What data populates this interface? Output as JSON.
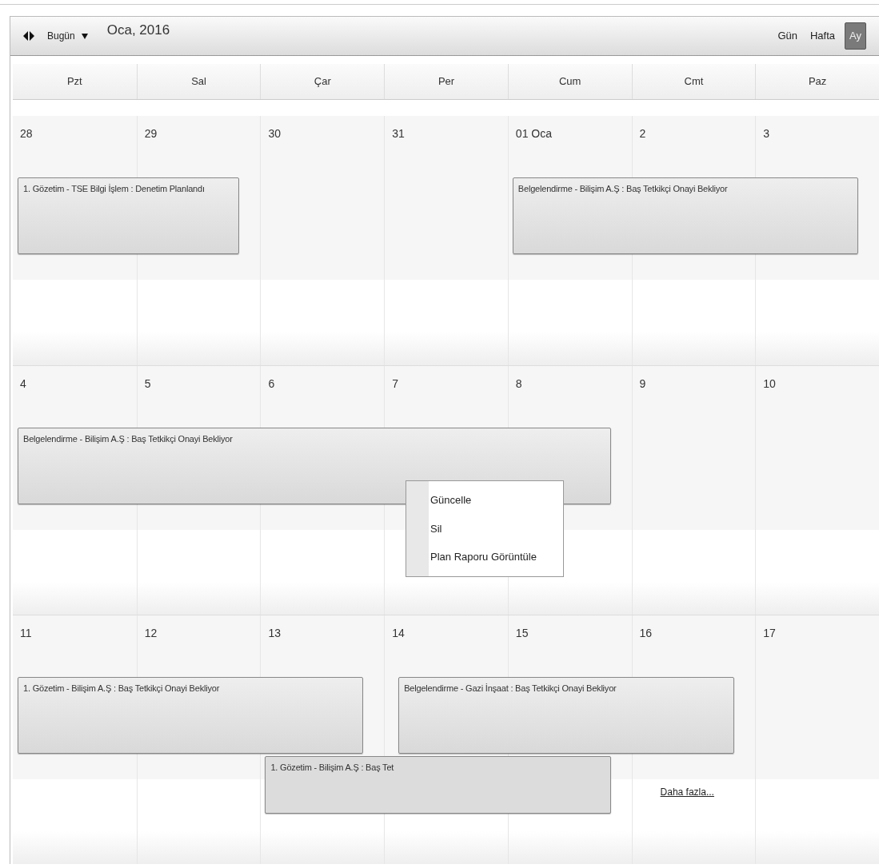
{
  "toolbar": {
    "today_button": "Bugün",
    "title": "Oca, 2016",
    "views": [
      {
        "label": "Gün",
        "selected": false
      },
      {
        "label": "Hafta",
        "selected": false
      },
      {
        "label": "Ay",
        "selected": true
      }
    ]
  },
  "weekdays": [
    "Pzt",
    "Sal",
    "Çar",
    "Per",
    "Cum",
    "Cmt",
    "Paz"
  ],
  "weeks": [
    {
      "days": [
        {
          "label": "28"
        },
        {
          "label": "29"
        },
        {
          "label": "30"
        },
        {
          "label": "31"
        },
        {
          "label": "01 Oca"
        },
        {
          "label": "2"
        },
        {
          "label": "3"
        }
      ],
      "events": [
        {
          "title": "1. Gözetim - TSE Bilgi İşlem : Denetim Planlandı"
        },
        {
          "title": "Belgelendirme - Bilişim A.Ş : Baş Tetkikçi Onayi Bekliyor"
        }
      ]
    },
    {
      "days": [
        {
          "label": "4"
        },
        {
          "label": "5"
        },
        {
          "label": "6"
        },
        {
          "label": "7"
        },
        {
          "label": "8"
        },
        {
          "label": "9"
        },
        {
          "label": "10"
        }
      ],
      "events": [
        {
          "title": "Belgelendirme - Bilişim A.Ş : Baş Tetkikçi Onayi Bekliyor"
        }
      ]
    },
    {
      "days": [
        {
          "label": "11"
        },
        {
          "label": "12"
        },
        {
          "label": "13"
        },
        {
          "label": "14"
        },
        {
          "label": "15"
        },
        {
          "label": "16",
          "more": "Daha fazla..."
        },
        {
          "label": "17"
        }
      ],
      "events": [
        {
          "title": "1. Gözetim - Bilişim A.Ş : Baş Tetkikçi Onayi Bekliyor"
        },
        {
          "title": "1. Gözetim - Bilişim A.Ş : Baş Tet"
        },
        {
          "title": "Belgelendirme - Gazi İnşaat : Baş Tetkikçi Onayi Bekliyor"
        }
      ]
    }
  ],
  "context_menu": {
    "items": [
      "Güncelle",
      "Sil",
      "Plan Raporu Görüntüle"
    ]
  }
}
